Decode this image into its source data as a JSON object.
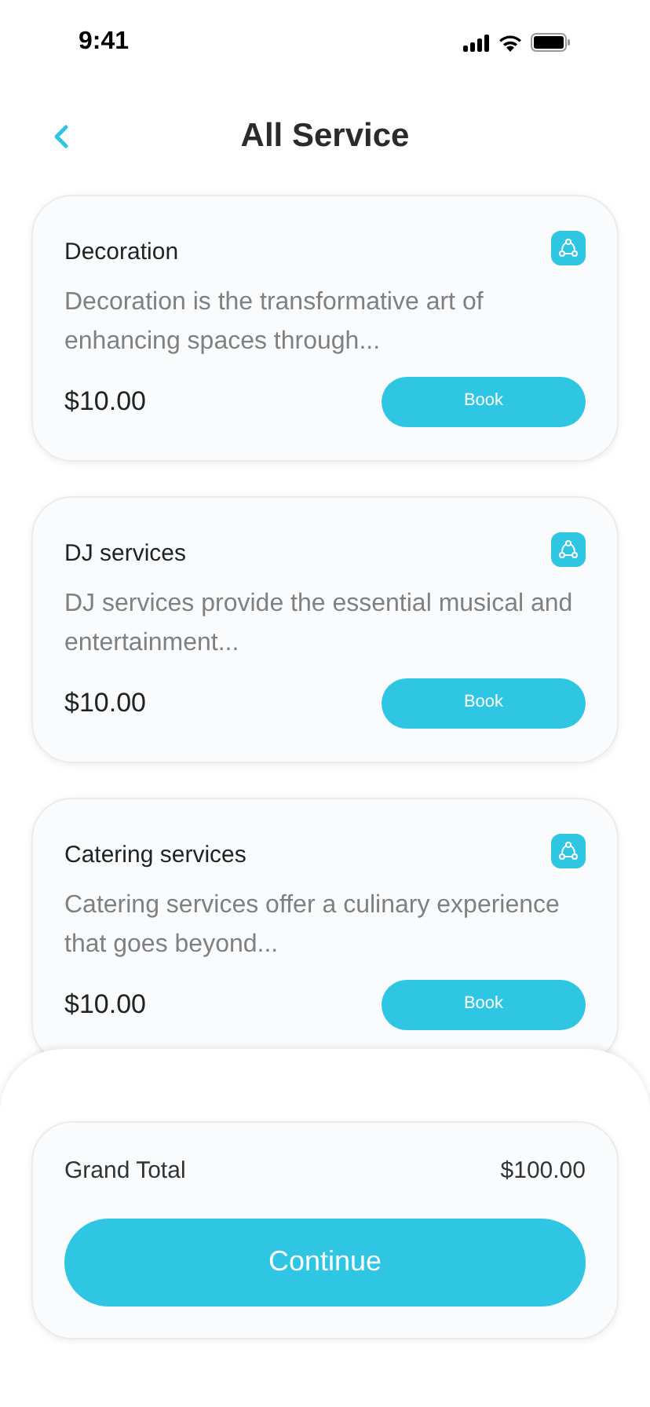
{
  "status_bar": {
    "time": "9:41"
  },
  "header": {
    "title": "All Service"
  },
  "services": [
    {
      "name": "Decoration",
      "description": "Decoration is the transformative art of enhancing spaces through...",
      "price": "$10.00",
      "action": "Book"
    },
    {
      "name": "DJ services",
      "description": "DJ services provide the essential musical and entertainment...",
      "price": "$10.00",
      "action": "Book"
    },
    {
      "name": "Catering services",
      "description": "Catering services offer a culinary experience that goes beyond...",
      "price": "$10.00",
      "action": "Book"
    }
  ],
  "summary": {
    "label": "Grand Total",
    "total": "$100.00",
    "button": "Continue"
  }
}
